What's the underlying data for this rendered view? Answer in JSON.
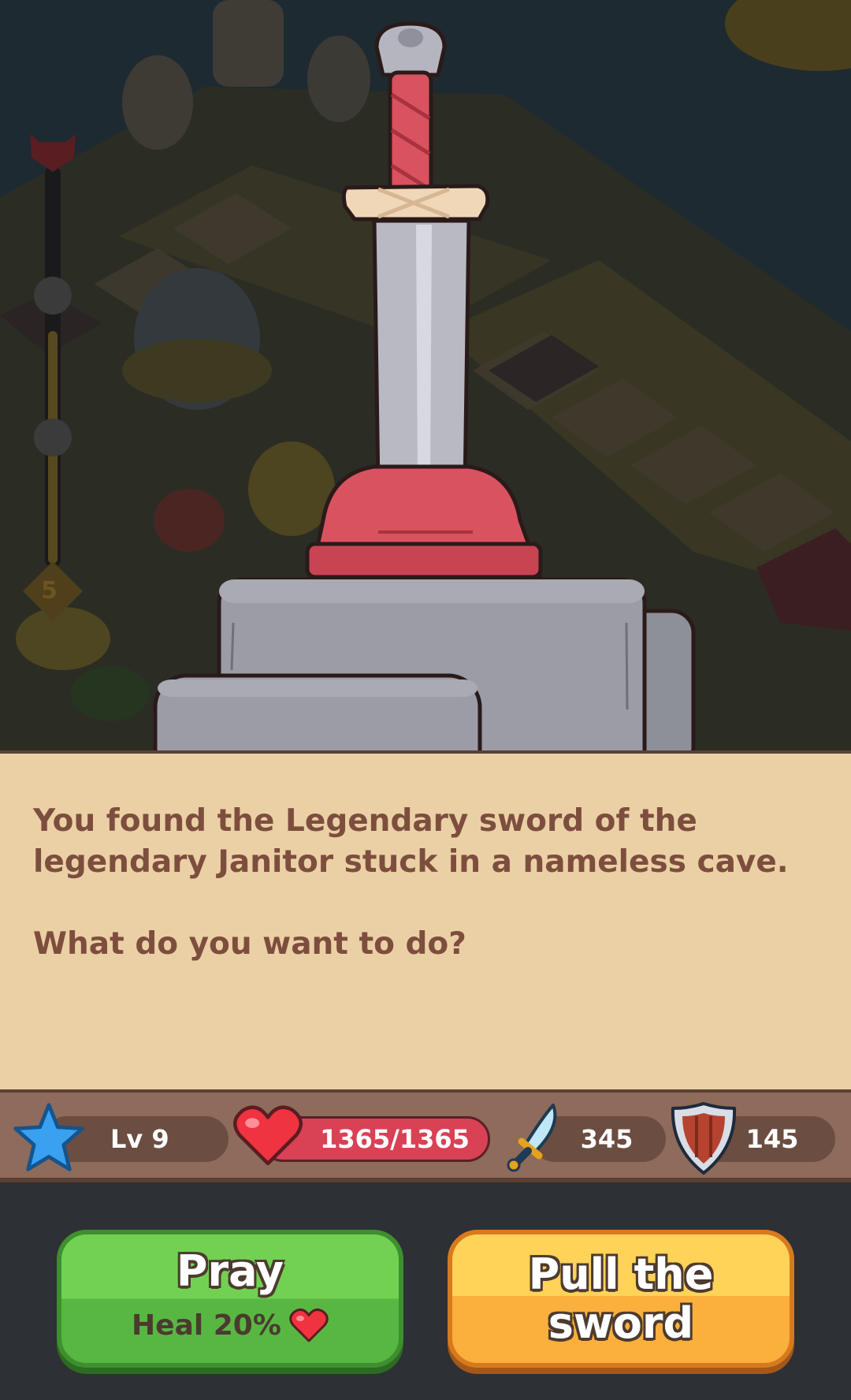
{
  "scene": {
    "progress_track": {
      "level_badge": "5"
    }
  },
  "event": {
    "message": "You found the Legendary sword of the legendary Janitor stuck in a nameless cave.",
    "question": "What do you want to do?"
  },
  "stats": {
    "level": "Lv 9",
    "health": "1365/1365",
    "health_fraction": 1.0,
    "attack": "345",
    "defense": "145"
  },
  "actions": {
    "pray": {
      "title": "Pray",
      "subtitle": "Heal 20%"
    },
    "pull": {
      "title": "Pull the sword"
    }
  },
  "colors": {
    "pray_button": "#58b743",
    "pull_button": "#fbaf3c",
    "panel": "#ebd0a6",
    "text": "#7d4e3e",
    "health_bar": "#d94155"
  }
}
